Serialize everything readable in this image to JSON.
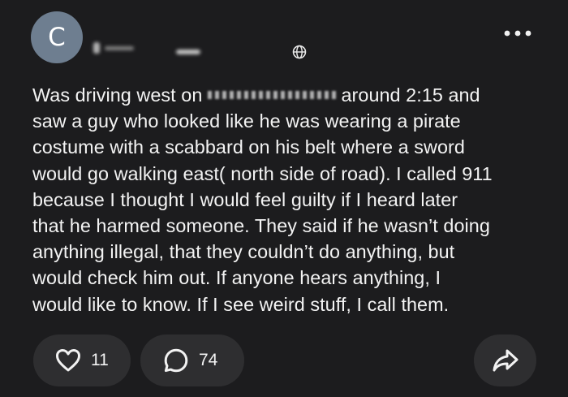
{
  "post": {
    "avatar_letter": "C",
    "body_lines": [
      [
        "Was driving west on ",
        "",
        " around 2:15 and"
      ],
      [
        "saw a guy who looked like he was wearing a pirate"
      ],
      [
        "costume with a scabbard on his belt where a sword"
      ],
      [
        "would go walking east( north side of road). I called 911"
      ],
      [
        "because I thought I would feel guilty if I heard later"
      ],
      [
        "that he harmed someone. They said if he wasn’t doing"
      ],
      [
        "anything illegal, that they couldn’t do anything, but"
      ],
      [
        "would check him out. If anyone hears anything, I"
      ],
      [
        "would like to know. If I see weird stuff, I call them."
      ]
    ]
  },
  "actions": {
    "like_count": "11",
    "comment_count": "74"
  },
  "icons": {
    "globe": "globe-icon",
    "more": "more-horizontal-icon",
    "like": "heart-icon",
    "comment": "comment-bubble-icon",
    "share": "share-arrow-icon"
  },
  "colors": {
    "background": "#1c1c1e",
    "avatar": "#6e7e90",
    "pill": "#2e2e30",
    "text": "#f3f3f3"
  }
}
